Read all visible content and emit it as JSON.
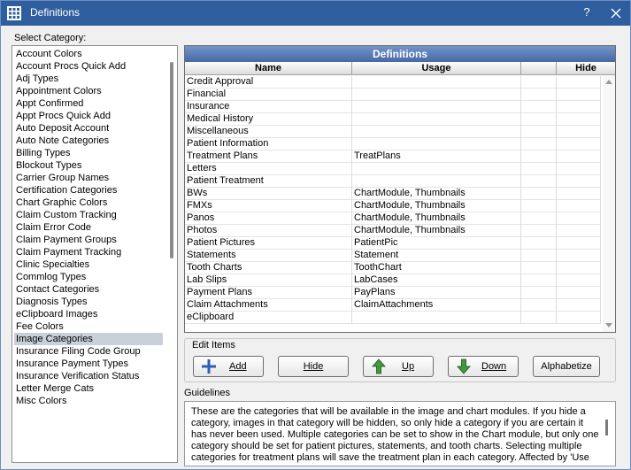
{
  "window": {
    "title": "Definitions",
    "help_label": "?"
  },
  "category": {
    "label": "Select Category:",
    "items": [
      "Account Colors",
      "Account Procs Quick Add",
      "Adj Types",
      "Appointment Colors",
      "Appt Confirmed",
      "Appt Procs Quick Add",
      "Auto Deposit Account",
      "Auto Note Categories",
      "Billing Types",
      "Blockout Types",
      "Carrier Group Names",
      "Certification Categories",
      "Chart Graphic Colors",
      "Claim Custom Tracking",
      "Claim Error Code",
      "Claim Payment Groups",
      "Claim Payment Tracking",
      "Clinic Specialties",
      "Commlog Types",
      "Contact Categories",
      "Diagnosis Types",
      "eClipboard Images",
      "Fee Colors",
      "Image Categories",
      "Insurance Filing Code Group",
      "Insurance Payment Types",
      "Insurance Verification Status",
      "Letter Merge Cats",
      "Misc Colors"
    ],
    "selected_index": 23
  },
  "grid": {
    "title": "Definitions",
    "columns": [
      "Name",
      "Usage",
      "",
      "Hide"
    ],
    "rows": [
      {
        "name": "Credit Approval",
        "usage": ""
      },
      {
        "name": "Financial",
        "usage": ""
      },
      {
        "name": "Insurance",
        "usage": ""
      },
      {
        "name": "Medical History",
        "usage": ""
      },
      {
        "name": "Miscellaneous",
        "usage": ""
      },
      {
        "name": "Patient Information",
        "usage": ""
      },
      {
        "name": "Treatment Plans",
        "usage": "TreatPlans"
      },
      {
        "name": "Letters",
        "usage": ""
      },
      {
        "name": "Patient Treatment",
        "usage": ""
      },
      {
        "name": "BWs",
        "usage": "ChartModule, Thumbnails"
      },
      {
        "name": "FMXs",
        "usage": "ChartModule, Thumbnails"
      },
      {
        "name": "Panos",
        "usage": "ChartModule, Thumbnails"
      },
      {
        "name": "Photos",
        "usage": "ChartModule, Thumbnails"
      },
      {
        "name": "Patient Pictures",
        "usage": "PatientPic"
      },
      {
        "name": "Statements",
        "usage": "Statement"
      },
      {
        "name": "Tooth Charts",
        "usage": "ToothChart"
      },
      {
        "name": "Lab Slips",
        "usage": "LabCases"
      },
      {
        "name": "Payment Plans",
        "usage": "PayPlans"
      },
      {
        "name": "Claim Attachments",
        "usage": "ClaimAttachments"
      },
      {
        "name": "eClipboard",
        "usage": ""
      }
    ]
  },
  "edit_items": {
    "title": "Edit Items",
    "add_label": "Add",
    "hide_label": "Hide",
    "up_label": "Up",
    "down_label": "Down",
    "alphabetize_label": "Alphabetize"
  },
  "guidelines": {
    "label": "Guidelines",
    "text": "These are the categories that will be available in the image and chart modules.  If you hide a category, images in that category will be hidden, so only hide a category if you are certain it has never been used.  Multiple categories can be set to show in the Chart module, but only one category should be set for patient pictures, statements, and tooth charts. Selecting multiple categories for treatment plans will save the treatment plan in each category. Affected by 'Use"
  },
  "colors": {
    "titlebar": "#2e5e9e",
    "grid_header": "#4868a6",
    "selection": "#c8d0dc",
    "add_icon": "#2f5fb3",
    "arrow_icon": "#3f9a3a"
  },
  "icons": [
    "app-grid-icon",
    "close-icon",
    "plus-icon",
    "up-arrow-icon",
    "down-arrow-icon"
  ]
}
